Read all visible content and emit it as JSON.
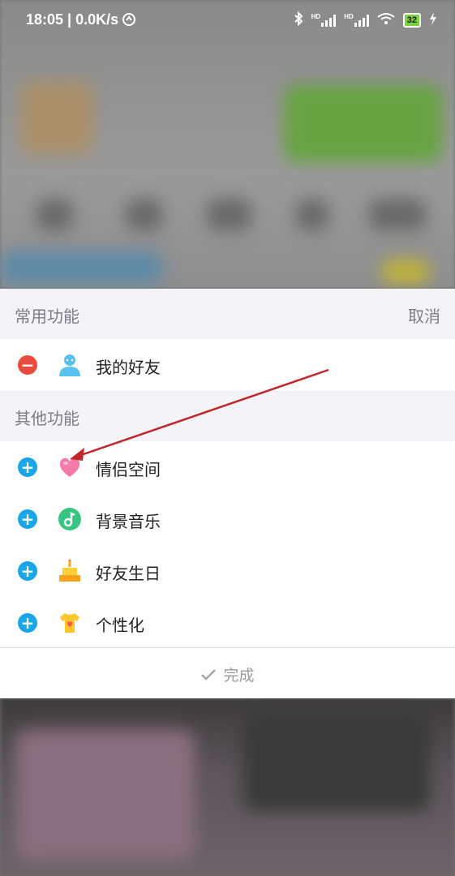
{
  "status_bar": {
    "time": "18:05 | 0.0K/s",
    "signal_label_1": "HD",
    "signal_label_2": "HD",
    "battery": "32"
  },
  "common_section": {
    "title": "常用功能",
    "cancel_label": "取消",
    "items": [
      {
        "label": "我的好友",
        "icon": "friends-icon",
        "action": "remove"
      }
    ]
  },
  "other_section": {
    "title": "其他功能",
    "items": [
      {
        "label": "情侣空间",
        "icon": "heart-icon",
        "action": "add"
      },
      {
        "label": "背景音乐",
        "icon": "music-note-icon",
        "action": "add"
      },
      {
        "label": "好友生日",
        "icon": "birthday-cake-icon",
        "action": "add"
      },
      {
        "label": "个性化",
        "icon": "tshirt-icon",
        "action": "add"
      }
    ]
  },
  "done_label": "完成",
  "colors": {
    "remove_accent": "#ea4b3c",
    "add_accent": "#17a6e8",
    "annotation_arrow": "#c0262a"
  }
}
